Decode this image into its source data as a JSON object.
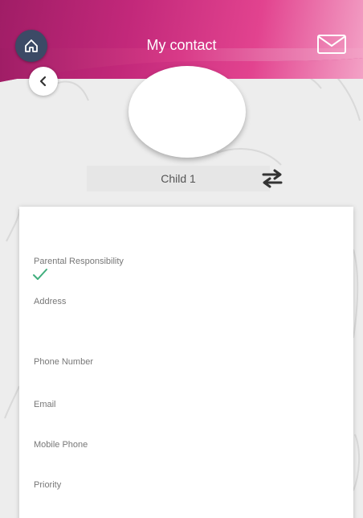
{
  "header": {
    "title": "My contact",
    "home_icon": "home-icon",
    "mail_icon": "mail-icon",
    "back_icon": "chevron-left-icon",
    "back_label": "<"
  },
  "profile": {
    "child_name": "Child 1",
    "switch_icon": "swap-arrows-icon"
  },
  "details": {
    "fields": [
      {
        "label": "Parental Responsibility"
      },
      {
        "label": "Address"
      },
      {
        "label": "Phone Number"
      },
      {
        "label": "Email"
      },
      {
        "label": "Mobile Phone"
      },
      {
        "label": "Priority"
      }
    ],
    "parental_responsibility_checked": true,
    "check_icon": "checkmark-icon"
  },
  "colors": {
    "header_start": "#a01d66",
    "header_end": "#f3a2c6",
    "home_button": "#3c4a66",
    "check": "#3fae7c"
  }
}
